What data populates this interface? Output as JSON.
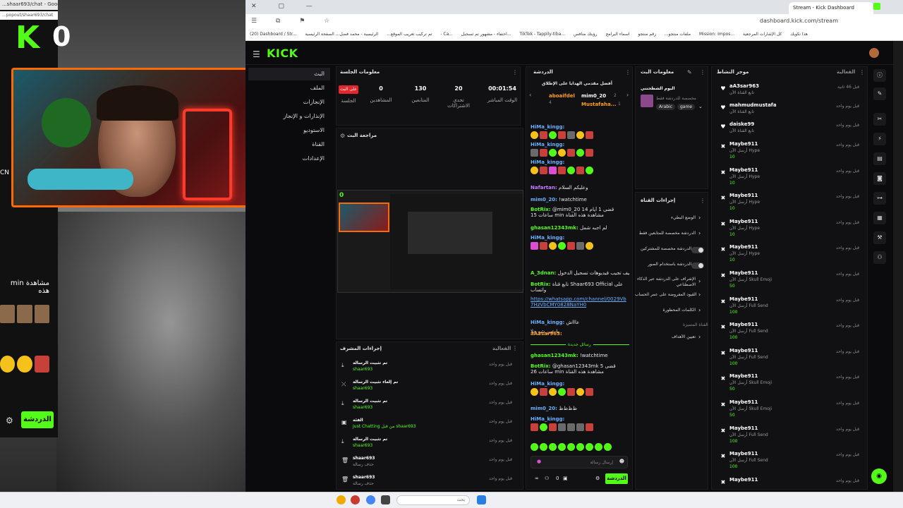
{
  "left": {
    "chrome_title": "...shaar693/chat - Google Chrome",
    "url": "...popout/shaar693/chat",
    "kick_glyph": "K",
    "zero": "0",
    "watch_text": "min مشاهدة هذه",
    "side_text": "CN",
    "chat_button": "الدردشة"
  },
  "browser": {
    "tab_title": "Stream - Kick Dashboard",
    "url": "dashboard.kick.com/stream",
    "bookmarks": [
      "(20) Dashboard / Str...",
      "تم تركيب تعريب الموقع...",
      "الرئيسية - محمد فضل...",
      "الصفحة الرئيسية - Ca...",
      "احتفاء - مشهور تم تسجيل...",
      "TikTok - Tappily-tiba...",
      "ملفات منتجو...",
      "زقم منتجو",
      "اسماء البرامج",
      "رؤيتك منافس",
      "Mission: Impos...",
      "هذا تكويك",
      "كل الإشارات المرجعية"
    ]
  },
  "kick": {
    "logo": "KICK",
    "nav": [
      {
        "label": "البث",
        "icon": "stream-icon"
      },
      {
        "label": "الملف",
        "icon": "profile-icon"
      },
      {
        "label": "الإنجازات",
        "icon": "achievements-icon"
      },
      {
        "label": "الإنذارات و الإنجاز",
        "icon": "alerts-icon"
      },
      {
        "label": "الاستوديو",
        "icon": "studio-icon"
      },
      {
        "label": "القناة",
        "icon": "channel-icon"
      },
      {
        "label": "الإعدادات",
        "icon": "settings-icon"
      }
    ],
    "session": {
      "title": "معلومات الجلسة",
      "live_badge": "على البث",
      "stats": [
        {
          "value": "00:01:54",
          "label": "الوقت المباشر"
        },
        {
          "value": "20",
          "label": "تحدي الاشتراكات"
        },
        {
          "value": "130",
          "label": "المتابعين"
        },
        {
          "value": "0",
          "label": "المشاهدين"
        },
        {
          "value": "",
          "label": "الجلسة"
        }
      ]
    },
    "preview": {
      "title": "مراجعة البث",
      "overlay": "0"
    },
    "mod_actions": {
      "title": "إجراءات المشرف",
      "filter": "الفعالية",
      "rows": [
        {
          "icon": "pin-icon",
          "title": "تم تثبيت الرسالة",
          "user": "shaar693",
          "time": "قبل يوم واحد"
        },
        {
          "icon": "unpin-icon",
          "title": "تم إلغاء تثبيت الرسالة",
          "user": "shaar693",
          "time": "قبل يوم واحد"
        },
        {
          "icon": "pin-icon",
          "title": "تم تثبيت الرسالة",
          "user": "shaar693",
          "time": "قبل يوم واحد"
        },
        {
          "icon": "category-icon",
          "title": "الفئة",
          "user": "Just Chatting من قبل shaar693",
          "time": "قبل يوم واحد"
        },
        {
          "icon": "pin-icon",
          "title": "تم تثبيت الرسالة",
          "user": "shaar693",
          "time": "قبل يوم واحد"
        },
        {
          "icon": "trash-icon",
          "title": "shaar693",
          "user": "حذف رسالة",
          "time": "قبل يوم واحد"
        },
        {
          "icon": "trash-icon",
          "title": "shaar693",
          "user": "حذف رسالة",
          "time": "قبل يوم واحد"
        }
      ]
    },
    "chat": {
      "title": "الدردشة",
      "top_gifters_title": "أفضل مقدمي الهدايا على الإطلاق",
      "gifters": [
        {
          "name": "aboaifdel",
          "count": "4"
        },
        {
          "name": "mim0_20",
          "count": "2"
        },
        {
          "name": "Mustafaha...",
          "count": "1"
        }
      ],
      "lines": [
        {
          "user": "HiMa_kingg:",
          "text": "",
          "color": "#6ab0ff"
        },
        {
          "user": "HiMa_kingg:",
          "text": "",
          "color": "#6ab0ff"
        },
        {
          "user": "HiMa_kingg:",
          "text": "",
          "color": "#6ab0ff"
        },
        {
          "user": "Nafartan:",
          "text": "وعليكم السلام",
          "color": "#c77dff"
        },
        {
          "user": "mim0_20:",
          "text": "!watchtime",
          "color": "#6ab0ff"
        },
        {
          "user": "BotRix:",
          "text": "@mim0_20 قضى 1 أيام 14 ساعات 15 min مشاهدة هذه القناة",
          "color": "#53fc18"
        },
        {
          "user": "ghasan12343mk:",
          "text": "لم اجبه شمل",
          "color": "#53fc18"
        },
        {
          "user": "HiMa_kingg:",
          "text": "",
          "color": "#6ab0ff"
        },
        {
          "user": "A_3dnan:",
          "text": "شمل كيف تجيب فيديوهات تسجيل الدخول",
          "color": "#53fc18"
        },
        {
          "user": "BotRix:",
          "text": "تابع قناة Shaar693 Official على واتساب",
          "color": "#53fc18"
        },
        {
          "user": "",
          "text": "https://whatsapp.com/channel/0029Vb7HzVbCMY0828NaYH0",
          "color": "#6ab0ff"
        },
        {
          "user": "HiMa_kingg:",
          "text": "عاااش",
          "color": "#6ab0ff"
        },
        {
          "user": "",
          "text": "يا عين شو حلا",
          "color": "#ddd"
        },
        {
          "user": "aA3sar963:",
          "text": "",
          "color": "#ff9f1a"
        }
      ],
      "new_messages": "رسائل جديدة",
      "lines2": [
        {
          "user": "ghasan12343mk:",
          "text": "!watchtime",
          "color": "#53fc18"
        },
        {
          "user": "BotRix:",
          "text": "@ghasan12343mk قضى 5 ساعات 26 min مشاهدة هذه القناة",
          "color": "#53fc18"
        },
        {
          "user": "HiMa_kingg:",
          "text": "",
          "color": "#6ab0ff"
        },
        {
          "user": "mim0_20:",
          "text": "ظ‌ظ‌ظ‌ظ‌",
          "color": "#6ab0ff"
        },
        {
          "user": "HiMa_kingg:",
          "text": "",
          "color": "#6ab0ff"
        }
      ],
      "input_placeholder": "إرسال رسالة",
      "send": "الدردشة",
      "viewer_count": "0"
    },
    "stream_info": {
      "title": "معلومات البث",
      "stream_title": "اليوم الشطحنني",
      "category": "مخصصة للدردشة فقط",
      "tags": [
        "Arabic",
        "game"
      ]
    },
    "channel_actions": {
      "title": "إجراءات القناة",
      "rows": [
        {
          "label": "الوضع البطيء",
          "type": "chevron"
        },
        {
          "label": "الدردشة مخصصة للمتابعين فقط",
          "type": "chevron"
        },
        {
          "label": "الدردشة مخصصة للمشتركين",
          "type": "toggle"
        },
        {
          "label": "الدردشة باستخدام الصور",
          "type": "toggle"
        },
        {
          "label": "الإشراف على الدردشة عبر الذكاء الاصطناعي",
          "type": "chevron"
        },
        {
          "label": "القيود المفروضة على عمر الحساب",
          "type": "chevron"
        },
        {
          "label": "الكلمات المحظورة",
          "type": "chevron"
        }
      ],
      "sub_title": "القناة المتميزة",
      "goals": "تعيين الأهداف"
    },
    "activity": {
      "title": "موجز النشاط",
      "filter": "الفعالية",
      "items": [
        {
          "icon": "heart-icon",
          "name": "aA3sar963",
          "sub": "تابع القناة الآن",
          "amount": "",
          "time": "قبل 46 ثانية"
        },
        {
          "icon": "heart-icon",
          "name": "mahmudmustafa",
          "sub": "تابع القناة الآن",
          "amount": "",
          "time": "قبل يوم واحد"
        },
        {
          "icon": "heart-icon",
          "name": "daiske99",
          "sub": "تابع القناة الآن",
          "amount": "",
          "time": "قبل يوم واحد"
        },
        {
          "icon": "kicks-icon",
          "name": "Maybe911",
          "sub": "أرسل الآن Hype",
          "amount": "10",
          "time": "قبل يوم واحد"
        },
        {
          "icon": "kicks-icon",
          "name": "Maybe911",
          "sub": "أرسل الآن Hype",
          "amount": "10",
          "time": "قبل يوم واحد"
        },
        {
          "icon": "kicks-icon",
          "name": "Maybe911",
          "sub": "أرسل الآن Hype",
          "amount": "10",
          "time": "قبل يوم واحد"
        },
        {
          "icon": "kicks-icon",
          "name": "Maybe911",
          "sub": "أرسل الآن Hype",
          "amount": "10",
          "time": "قبل يوم واحد"
        },
        {
          "icon": "kicks-icon",
          "name": "Maybe911",
          "sub": "أرسل الآن Hype",
          "amount": "10",
          "time": "قبل يوم واحد"
        },
        {
          "icon": "kicks-icon",
          "name": "Maybe911",
          "sub": "أرسل الآن Skull Emoji",
          "amount": "50",
          "time": "قبل يوم واحد"
        },
        {
          "icon": "kicks-icon",
          "name": "Maybe911",
          "sub": "أرسل الآن Full Send",
          "amount": "100",
          "time": "قبل يوم واحد"
        },
        {
          "icon": "kicks-icon",
          "name": "Maybe911",
          "sub": "أرسل الآن Full Send",
          "amount": "100",
          "time": "قبل يوم واحد"
        },
        {
          "icon": "kicks-icon",
          "name": "Maybe911",
          "sub": "أرسل الآن Full Send",
          "amount": "100",
          "time": "قبل يوم واحد"
        },
        {
          "icon": "kicks-icon",
          "name": "Maybe911",
          "sub": "أرسل الآن Skull Emoji",
          "amount": "50",
          "time": "قبل يوم واحد"
        },
        {
          "icon": "kicks-icon",
          "name": "Maybe911",
          "sub": "أرسل الآن Skull Emoji",
          "amount": "50",
          "time": "قبل يوم واحد"
        },
        {
          "icon": "kicks-icon",
          "name": "Maybe911",
          "sub": "أرسل الآن Full Send",
          "amount": "100",
          "time": "قبل يوم واحد"
        },
        {
          "icon": "kicks-icon",
          "name": "Maybe911",
          "sub": "أرسل الآن Full Send",
          "amount": "100",
          "time": "قبل يوم واحد"
        },
        {
          "icon": "kicks-icon",
          "name": "Maybe911",
          "sub": "",
          "amount": "",
          "time": "قبل يوم واحد"
        }
      ]
    }
  },
  "taskbar": {
    "search_placeholder": "بحث"
  },
  "colors": {
    "accent": "#53fc18",
    "live": "#e0282e",
    "cam_border": "#ff6a00"
  }
}
